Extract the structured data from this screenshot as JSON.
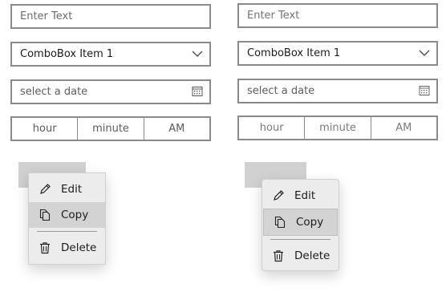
{
  "left": {
    "textbox_placeholder": "Enter Text",
    "combobox_value": "ComboBox Item 1",
    "datepicker_placeholder": "select a date",
    "time": {
      "hour": "hour",
      "minute": "minute",
      "period": "AM"
    },
    "menu": {
      "edit": "Edit",
      "copy": "Copy",
      "delete": "Delete"
    }
  },
  "right": {
    "textbox_placeholder": "Enter Text",
    "combobox_value": "ComboBox Item 1",
    "datepicker_placeholder": "select a date",
    "time": {
      "hour": "hour",
      "minute": "minute",
      "period": "AM"
    },
    "menu": {
      "edit": "Edit",
      "copy": "Copy",
      "delete": "Delete"
    }
  },
  "icons": {
    "edit": "pencil-icon",
    "copy": "copy-icon",
    "delete": "trash-icon",
    "combo": "chevron-down-icon",
    "date": "calendar-icon"
  },
  "colors": {
    "border": "#8a8a8a",
    "menu_bg": "#ececec",
    "highlight": "#d3d3d3",
    "anchor": "#d1d1d1"
  }
}
